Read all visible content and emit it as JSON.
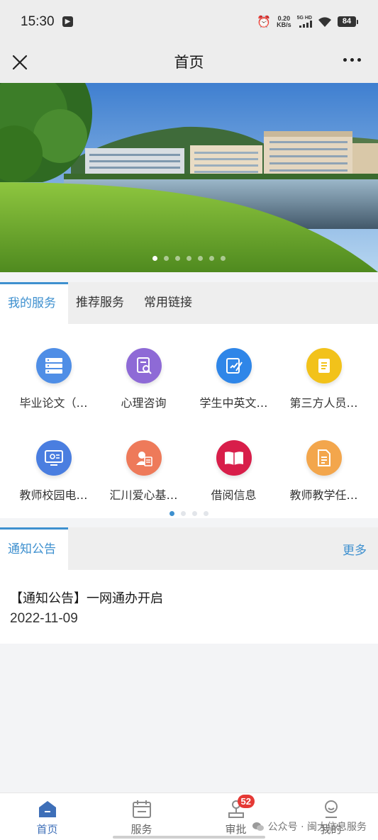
{
  "status_bar": {
    "time": "15:30",
    "speed_value": "0.20",
    "speed_unit": "KB/s",
    "network": "5G HD",
    "battery": "84"
  },
  "header": {
    "title": "首页"
  },
  "banner": {
    "page_count": 7,
    "active_index": 0
  },
  "tabs": [
    {
      "label": "我的服务",
      "active": true
    },
    {
      "label": "推荐服务",
      "active": false
    },
    {
      "label": "常用链接",
      "active": false
    }
  ],
  "services": [
    {
      "label": "毕业论文（…",
      "icon": "server-list-icon",
      "color": "#4f8ee6"
    },
    {
      "label": "心理咨询",
      "icon": "document-search-icon",
      "color": "#8e6ad6"
    },
    {
      "label": "学生中英文…",
      "icon": "edit-document-icon",
      "color": "#2f86e8"
    },
    {
      "label": "第三方人员…",
      "icon": "note-icon",
      "color": "#f2c21a"
    },
    {
      "label": "教师校园电…",
      "icon": "monitor-icon",
      "color": "#4a7ee0"
    },
    {
      "label": "汇川爱心基…",
      "icon": "person-document-icon",
      "color": "#ee7a5a"
    },
    {
      "label": "借阅信息",
      "icon": "open-book-icon",
      "color": "#d81e4a"
    },
    {
      "label": "教师教学任…",
      "icon": "task-document-icon",
      "color": "#f3a64c"
    }
  ],
  "services_pager": {
    "page_count": 4,
    "active_index": 0
  },
  "notice": {
    "tab_label": "通知公告",
    "more_label": "更多",
    "items": [
      {
        "title": "【通知公告】一网通办开启",
        "date": "2022-11-09"
      }
    ]
  },
  "bottom_nav": {
    "items": [
      {
        "label": "首页",
        "icon": "home-icon",
        "active": true
      },
      {
        "label": "服务",
        "icon": "calendar-icon",
        "active": false
      },
      {
        "label": "审批",
        "icon": "approval-icon",
        "active": false,
        "badge": "52"
      },
      {
        "label": "我的",
        "icon": "user-icon",
        "active": false
      }
    ]
  },
  "watermark": "公众号 · 闽大信息服务",
  "colors": {
    "accent": "#3e90cf",
    "badge": "#e53935",
    "nav_active": "#3e6fb8"
  }
}
